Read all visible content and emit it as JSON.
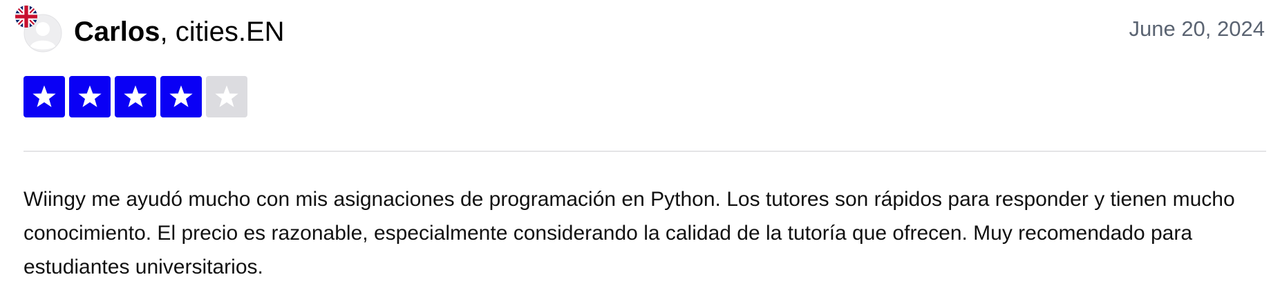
{
  "review": {
    "reviewer_name": "Carlos",
    "separator": ", ",
    "reviewer_location": "cities.EN",
    "date": "June 20, 2024",
    "rating": {
      "filled": 4,
      "total": 5,
      "filled_color": "#0a00f5",
      "empty_color": "#dcdce0"
    },
    "body": "Wiingy me ayudó mucho con mis asignaciones de programación en Python. Los tutores son rápidos para responder y tienen mucho conocimiento. El precio es razonable, especialmente considerando la calidad de la tutoría que ofrecen. Muy recomendado para estudiantes universitarios."
  },
  "icons": {
    "flag": "uk-flag-icon",
    "avatar": "default-user-avatar-icon",
    "star": "star-icon"
  }
}
